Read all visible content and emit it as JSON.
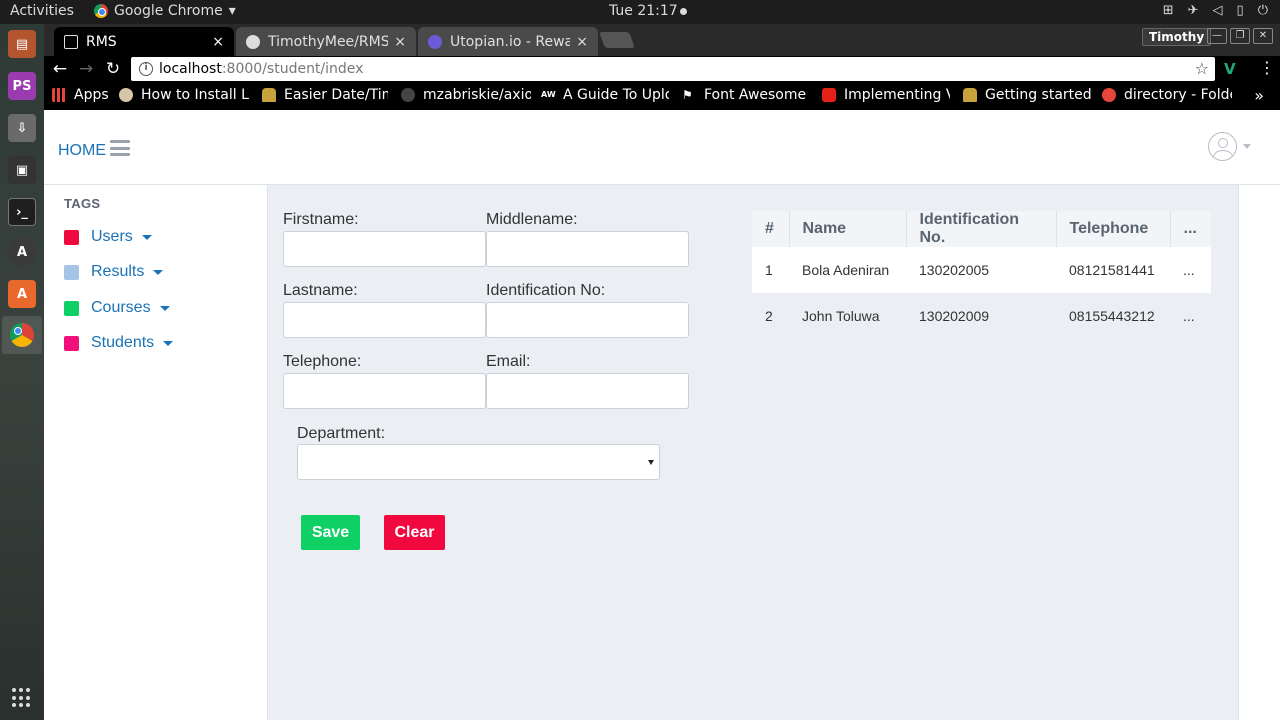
{
  "os_panel": {
    "activities": "Activities",
    "app_name": "Google Chrome",
    "app_caret": "▾",
    "clock": "Tue 21:17"
  },
  "browser": {
    "tabs": [
      {
        "title": "RMS",
        "close": "×"
      },
      {
        "title": "TimothyMee/RMS:",
        "close": "×"
      },
      {
        "title": "Utopian.io - Reward",
        "close": "×"
      }
    ],
    "profile": "Timothy",
    "url_host": "localhost",
    "url_path": ":8000/student/index",
    "bookmarks": [
      {
        "label": "Apps"
      },
      {
        "label": "How to Install La"
      },
      {
        "label": "Easier Date/Time"
      },
      {
        "label": "mzabriskie/axios"
      },
      {
        "label": "A Guide To Uploa"
      },
      {
        "label": "Font Awesome Ic"
      },
      {
        "label": "Implementing V"
      },
      {
        "label": "Getting started"
      },
      {
        "label": "directory - Folde"
      }
    ],
    "bookmarks_more": "»"
  },
  "app": {
    "home": "HOME",
    "sidebar": {
      "heading": "TAGS",
      "items": [
        {
          "label": "Users",
          "color": "#ee0a3e"
        },
        {
          "label": "Results",
          "color": "#a6c5e6"
        },
        {
          "label": "Courses",
          "color": "#0fd065"
        },
        {
          "label": "Students",
          "color": "#f0107b"
        }
      ]
    },
    "form": {
      "firstname_label": "Firstname:",
      "middlename_label": "Middlename:",
      "lastname_label": "Lastname:",
      "idno_label": "Identification No:",
      "telephone_label": "Telephone:",
      "email_label": "Email:",
      "department_label": "Department:",
      "firstname_value": "",
      "middlename_value": "",
      "lastname_value": "",
      "idno_value": "",
      "telephone_value": "",
      "email_value": "",
      "department_value": "",
      "save": "Save",
      "clear": "Clear",
      "save_color": "#0fd065",
      "clear_color": "#f0083e"
    },
    "table": {
      "headers": [
        "#",
        "Name",
        "Identification No.",
        "Telephone",
        "..."
      ],
      "rows": [
        [
          "1",
          "Bola Adeniran",
          "130202005",
          "08121581441",
          "..."
        ],
        [
          "2",
          "John Toluwa",
          "130202009",
          "08155443212",
          "..."
        ]
      ]
    }
  }
}
